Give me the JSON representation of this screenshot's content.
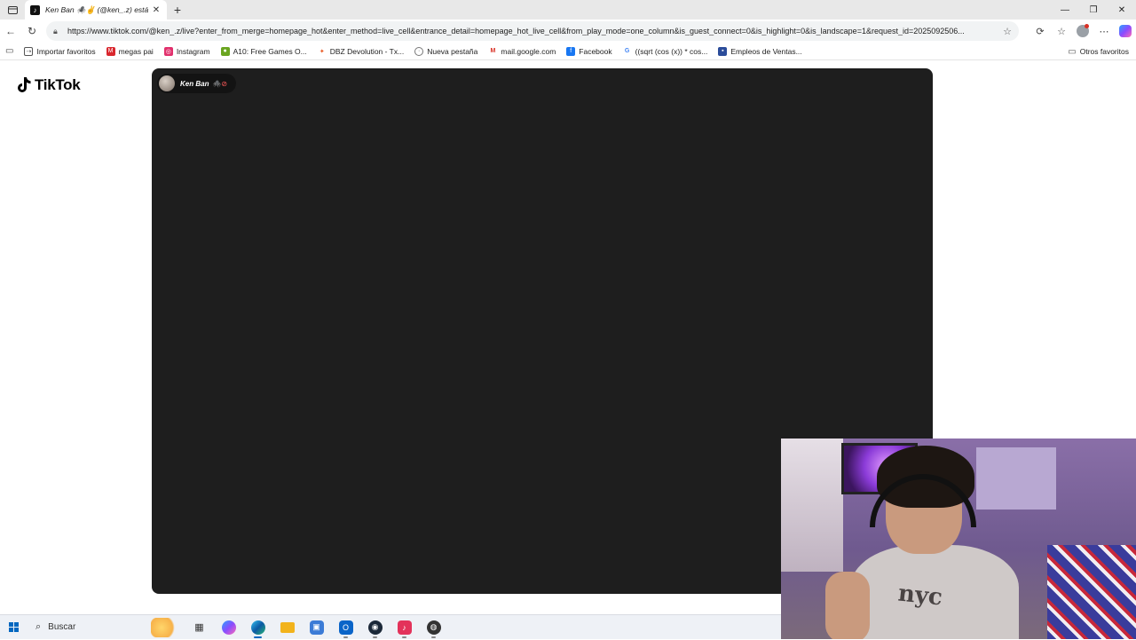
{
  "browser": {
    "tab": {
      "title": "Ken Ban 🕷️✌️ (@ken_.z) está LIVE",
      "favicon": "tiktok-icon"
    },
    "window_controls": {
      "minimize": "—",
      "restore": "❐",
      "close": "✕"
    },
    "new_tab_label": "+",
    "url": "https://www.tiktok.com/@ken_.z/live?enter_from_merge=homepage_hot&enter_method=live_cell&entrance_detail=homepage_hot_live_cell&from_play_mode=one_column&is_guest_connect=0&is_highlight=0&is_landscape=1&request_id=2025092506..."
  },
  "favorites": {
    "items": [
      {
        "label": "Importar favoritos",
        "icon": "import-icon",
        "color": "#555555"
      },
      {
        "label": "megas pai",
        "icon": "mega-icon",
        "color": "#d9272e"
      },
      {
        "label": "Instagram",
        "icon": "instagram-icon",
        "color": "#e1306c"
      },
      {
        "label": "A10: Free Games O...",
        "icon": "a10-icon",
        "color": "#6aa520"
      },
      {
        "label": "DBZ Devolution - Tx...",
        "icon": "dbz-icon",
        "color": "#e8541c"
      },
      {
        "label": "Nueva pestaña",
        "icon": "globe-icon",
        "color": "#555555"
      },
      {
        "label": "mail.google.com",
        "icon": "gmail-icon",
        "color": "#d93025"
      },
      {
        "label": "Facebook",
        "icon": "facebook-icon",
        "color": "#1877f2"
      },
      {
        "label": "((sqrt (cos (x)) * cos...",
        "icon": "google-icon",
        "color": "#4285f4"
      },
      {
        "label": "Empleos de Ventas...",
        "icon": "briefcase-icon",
        "color": "#2b4c9a"
      }
    ],
    "others_label": "Otros favoritos"
  },
  "page": {
    "logo_text": "TikTok",
    "host": {
      "name": "Ken Ban",
      "emoji": "🕷️⊘"
    }
  },
  "taskbar": {
    "search_label": "Buscar",
    "apps": [
      {
        "name": "task-view-icon",
        "color": "#333333",
        "glyph": "▦"
      },
      {
        "name": "copilot-app-icon",
        "color": "#7a5af8",
        "glyph": "◆"
      },
      {
        "name": "edge-icon",
        "color": "#0c8ad8",
        "glyph": "e"
      },
      {
        "name": "file-explorer-icon",
        "color": "#f2b31c",
        "glyph": "▬"
      },
      {
        "name": "store-icon",
        "color": "#3b7bd6",
        "glyph": "▣"
      },
      {
        "name": "outlook-icon",
        "color": "#0a64c8",
        "glyph": "O"
      },
      {
        "name": "steam-icon",
        "color": "#1b2838",
        "glyph": "◉"
      },
      {
        "name": "tiktok-app-icon",
        "color": "#e3325a",
        "glyph": "♪"
      },
      {
        "name": "obs-icon",
        "color": "#333333",
        "glyph": "◍"
      }
    ]
  },
  "webcam": {
    "shirt_text": "nyc"
  }
}
